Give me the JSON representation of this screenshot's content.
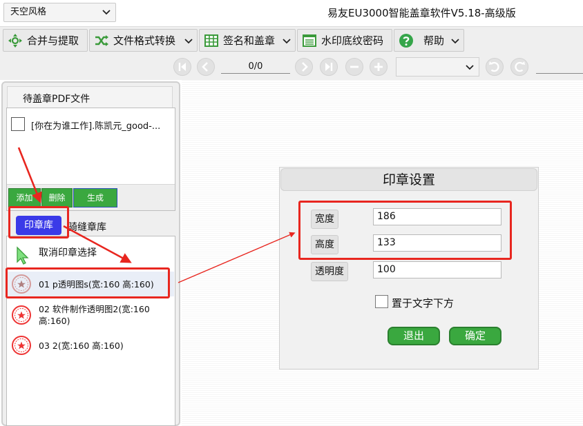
{
  "header": {
    "theme_select": "天空风格",
    "app_title": "易友EU3000智能盖章软件V5.18-高级版"
  },
  "toolbar": {
    "merge_extract": "合并与提取",
    "format_convert": "文件格式转换",
    "sign_stamp": "签名和盖章",
    "watermark": "水印底纹密码",
    "help": "帮助"
  },
  "nav": {
    "page_indicator": "0/0",
    "zoom_value": ""
  },
  "left_panel": {
    "file_tab": "待盖章PDF文件",
    "files": [
      {
        "name": "[你在为谁工作].陈凯元_good-...",
        "checked": false
      }
    ],
    "file_buttons": {
      "add": "添加",
      "delete": "删除",
      "generate": "生成"
    },
    "lib_tabs": {
      "seal_lib": "印章库",
      "riding_seal_lib": "骑缝章库"
    },
    "cancel_select": "取消印章选择",
    "seals": [
      {
        "line1": "01 p透明图s(宽:160 高:160)",
        "line2": "",
        "selected": true
      },
      {
        "line1": "02 软件制作透明图2(宽:160",
        "line2": "高:160)",
        "selected": false
      },
      {
        "line1": "03 2(宽:160 高:160)",
        "line2": "",
        "selected": false
      }
    ]
  },
  "dialog": {
    "title": "印章设置",
    "width_label": "宽度",
    "width_value": "186",
    "height_label": "高度",
    "height_value": "133",
    "opacity_label": "透明度",
    "opacity_value": "100",
    "below_text_label": "置于文字下方",
    "below_text_checked": false,
    "exit_button": "退出",
    "ok_button": "确定"
  },
  "colors": {
    "accent_green": "#3aa83f",
    "tab_blue": "#3a3ae8",
    "annotation_red": "#e8261f",
    "help_green": "#35a54a"
  },
  "icons": {
    "merge": "move-arrows-icon",
    "convert": "shuffle-icon",
    "sign": "grid-table-icon",
    "watermark": "list-window-icon",
    "help": "question-circle-icon",
    "cursor": "cursor-arrow-icon",
    "seal": "red-seal-icon"
  }
}
